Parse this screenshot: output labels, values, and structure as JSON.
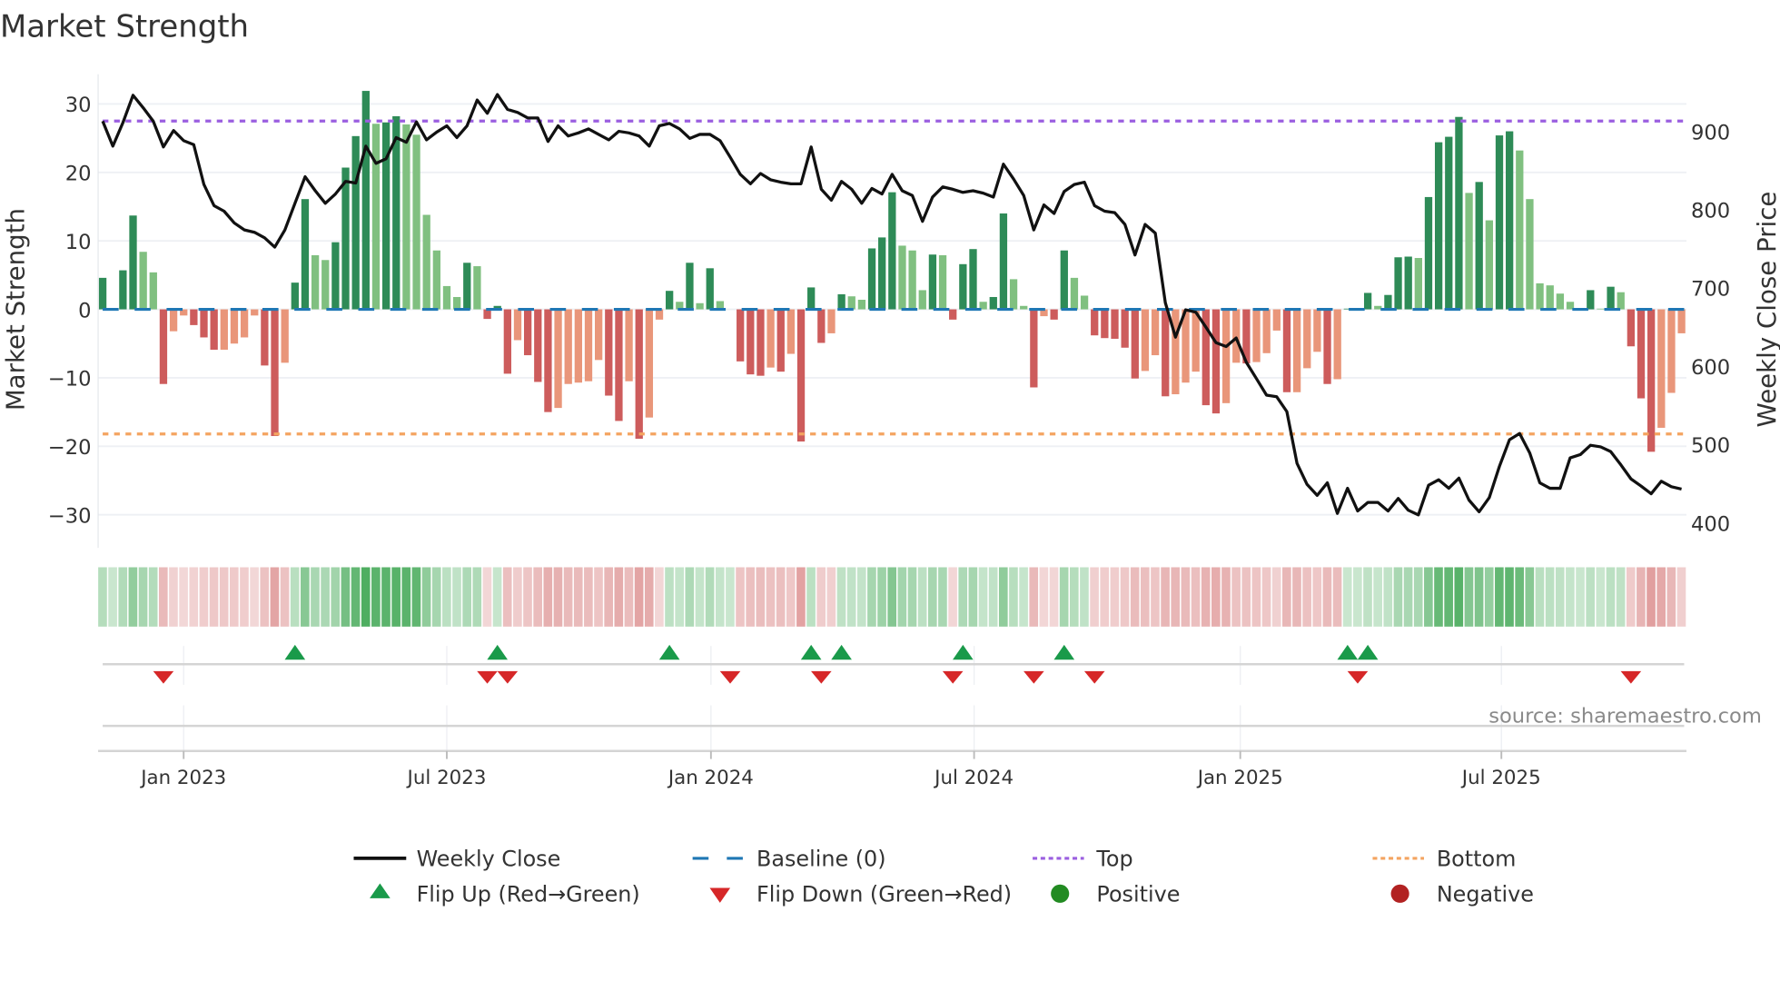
{
  "chart_data": {
    "type": "bar",
    "title": "Market Strength",
    "ylabel": "Market Strength",
    "y2label": "Weekly Close Price",
    "ylim": [
      -35,
      33
    ],
    "y2lim": [
      365,
      960
    ],
    "grid": true,
    "legend_placement": "bottom-center",
    "left_ticks": [
      {
        "value": 30,
        "label": "30"
      },
      {
        "value": 20,
        "label": "20"
      },
      {
        "value": 10,
        "label": "10"
      },
      {
        "value": 0,
        "label": "0"
      },
      {
        "value": -10,
        "label": "−10"
      },
      {
        "value": -20,
        "label": "−20"
      },
      {
        "value": -30,
        "label": "−30"
      }
    ],
    "right_ticks": [
      {
        "value": 900,
        "label": "900"
      },
      {
        "value": 800,
        "label": "800"
      },
      {
        "value": 700,
        "label": "700"
      },
      {
        "value": 600,
        "label": "600"
      },
      {
        "value": 500,
        "label": "500"
      },
      {
        "value": 400,
        "label": "400"
      }
    ],
    "x_ticks": [
      {
        "week": 8,
        "label": "Jan 2023"
      },
      {
        "week": 34,
        "label": "Jul 2023"
      },
      {
        "week": 60.1,
        "label": "Jan 2024"
      },
      {
        "week": 86.1,
        "label": "Jul 2024"
      },
      {
        "week": 112.4,
        "label": "Jan 2025"
      },
      {
        "week": 138.2,
        "label": "Jul 2025"
      }
    ],
    "top_level": 27.5,
    "bottom_level": -18.2,
    "baseline": 0,
    "strength": [
      4.6,
      0,
      5.7,
      13.7,
      8.4,
      5.4,
      -10.9,
      -3.2,
      -0.9,
      -2.3,
      -4.1,
      -5.9,
      -5.9,
      -5.0,
      -4.1,
      -0.9,
      -8.2,
      -18.5,
      -7.8,
      3.9,
      16.1,
      7.9,
      7.2,
      9.8,
      20.7,
      25.3,
      31.9,
      27.1,
      27.3,
      28.2,
      27.0,
      25.5,
      13.8,
      8.6,
      3.4,
      1.8,
      6.8,
      6.3,
      -1.4,
      0.5,
      -9.4,
      -4.5,
      -6.7,
      -10.6,
      -15.0,
      -14.4,
      -10.9,
      -10.7,
      -10.5,
      -7.4,
      -12.6,
      -16.3,
      -10.5,
      -18.9,
      -15.8,
      -1.5,
      2.7,
      1.1,
      6.8,
      0.9,
      6.0,
      1.2,
      0,
      -7.6,
      -9.5,
      -9.7,
      -8.5,
      -9.1,
      -6.5,
      -19.3,
      3.2,
      -4.9,
      -3.5,
      2.2,
      1.9,
      1.4,
      8.9,
      10.5,
      17.1,
      9.3,
      8.6,
      2.8,
      8.0,
      7.9,
      -1.5,
      6.6,
      8.8,
      1.1,
      1.8,
      14.0,
      4.4,
      0.5,
      -11.4,
      -1.0,
      -1.5,
      8.6,
      4.6,
      2.0,
      -3.8,
      -4.2,
      -4.3,
      -5.6,
      -10.1,
      -9.0,
      -6.7,
      -12.7,
      -12.4,
      -10.7,
      -9.1,
      -14.0,
      -15.2,
      -13.7,
      -7.8,
      -7.9,
      -7.7,
      -6.4,
      -3.1,
      -12.1,
      -12.1,
      -8.6,
      -6.2,
      -10.9,
      -10.2,
      0.1,
      0,
      2.4,
      0.5,
      2.1,
      7.6,
      7.7,
      7.5,
      16.4,
      24.4,
      25.2,
      28.1,
      17.0,
      18.6,
      13.0,
      25.4,
      26.0,
      23.2,
      16.1,
      3.8,
      3.5,
      2.3,
      1.1,
      0,
      2.8,
      0.1,
      3.3,
      2.5,
      -5.4,
      -13.0,
      -20.8,
      -17.3,
      -12.2,
      -3.5
    ],
    "weekly_close": [
      913,
      881,
      911,
      946,
      930,
      913,
      880,
      901,
      888,
      883,
      832,
      805,
      798,
      783,
      774,
      771,
      764,
      752,
      774,
      808,
      842,
      824,
      808,
      820,
      836,
      834,
      881,
      859,
      865,
      892,
      886,
      912,
      889,
      899,
      907,
      892,
      907,
      940,
      923,
      947,
      928,
      924,
      917,
      917,
      887,
      907,
      894,
      898,
      903,
      896,
      889,
      900,
      898,
      894,
      881,
      907,
      910,
      903,
      891,
      896,
      896,
      888,
      867,
      845,
      833,
      846,
      838,
      835,
      833,
      833,
      880,
      826,
      812,
      836,
      826,
      808,
      827,
      820,
      845,
      824,
      818,
      785,
      816,
      829,
      826,
      822,
      824,
      821,
      816,
      858,
      839,
      818,
      774,
      806,
      795,
      823,
      832,
      835,
      805,
      798,
      796,
      781,
      742,
      781,
      770,
      681,
      637,
      672,
      669,
      650,
      630,
      625,
      636,
      605,
      584,
      563,
      561,
      542,
      476,
      449,
      435,
      451,
      412,
      444,
      415,
      426,
      426,
      415,
      431,
      416,
      410,
      448,
      455,
      444,
      457,
      429,
      414,
      432,
      472,
      506,
      514,
      489,
      451,
      444,
      444,
      483,
      487,
      499,
      497,
      491,
      474,
      456,
      447,
      437,
      453,
      446,
      443
    ],
    "flip_up_weeks": [
      19,
      39,
      56,
      70,
      73,
      85,
      95,
      123,
      125
    ],
    "flip_down_weeks": [
      6,
      38,
      40,
      62,
      71,
      84,
      92,
      98,
      124,
      151
    ],
    "colors": {
      "bar_pos_rising": "#2e8b57",
      "bar_pos_falling": "#80c080",
      "bar_neg_falling": "#cd5c5c",
      "bar_neg_rising": "#e9967a",
      "weekly_close": "#111111",
      "baseline": "#1f77b4",
      "top": "#9b5fe0",
      "bottom": "#f4a460",
      "flip_up": "#1a9a4a",
      "flip_down": "#d62728",
      "positive": "#228b22",
      "negative": "#b22222"
    }
  },
  "source_text": "source: sharemaestro.com",
  "legend": {
    "weekly_close": "Weekly Close",
    "baseline": "Baseline (0)",
    "top": "Top",
    "bottom": "Bottom",
    "flip_up": "Flip Up (Red→Green)",
    "flip_down": "Flip Down (Green→Red)",
    "positive": "Positive",
    "negative": "Negative"
  }
}
